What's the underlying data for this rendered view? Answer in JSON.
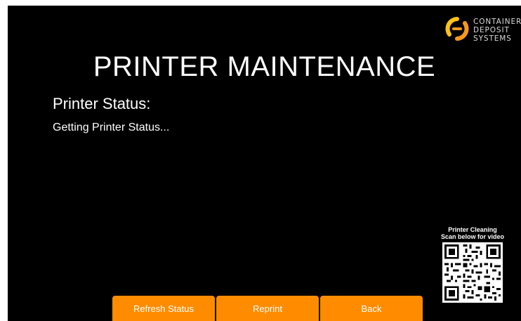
{
  "brand": {
    "name_lines": [
      "CONTAINER",
      "DEPOSIT",
      "SYSTEMS"
    ],
    "logo_icon": "cds-swirl-logo",
    "colors": {
      "orange": "#F59A1C",
      "yellow": "#FFC21A"
    }
  },
  "page": {
    "title": "PRINTER MAINTENANCE"
  },
  "status": {
    "label": "Printer Status:",
    "value": "Getting Printer Status..."
  },
  "help": {
    "line1": "Printer Cleaning",
    "line2": "Scan below for video",
    "qr_icon": "qr-code"
  },
  "buttons": {
    "refresh": "Refresh Status",
    "reprint": "Reprint",
    "back": "Back"
  },
  "theme": {
    "background": "#000000",
    "accent": "#FF8C00",
    "text": "#FFFFFF"
  }
}
